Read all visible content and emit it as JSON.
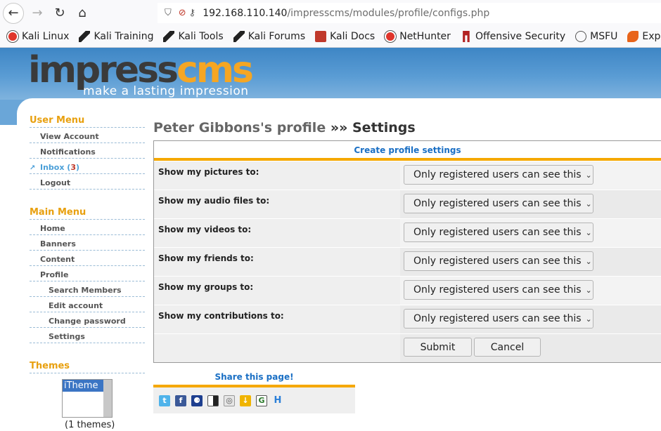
{
  "browser": {
    "url_host": "192.168.110.140",
    "url_path": "/impresscms/modules/profile/configs.php",
    "bookmarks": [
      {
        "label": "Kali Linux",
        "icon": "kali-icon"
      },
      {
        "label": "Kali Training",
        "icon": "kali-dragon-icon"
      },
      {
        "label": "Kali Tools",
        "icon": "kali-dragon-icon"
      },
      {
        "label": "Kali Forums",
        "icon": "kali-dragon-icon"
      },
      {
        "label": "Kali Docs",
        "icon": "kali-docs-icon"
      },
      {
        "label": "NetHunter",
        "icon": "kali-icon"
      },
      {
        "label": "Offensive Security",
        "icon": "offsec-icon"
      },
      {
        "label": "MSFU",
        "icon": "globe-icon"
      },
      {
        "label": "Exploit-DB",
        "icon": "exploitdb-icon"
      }
    ]
  },
  "logo": {
    "impress": "impress",
    "cms": "cms",
    "tagline": "make a lasting impression"
  },
  "sidebar": {
    "user_menu": {
      "title": "User Menu",
      "items": [
        "View Account",
        "Notifications",
        "Inbox",
        "Logout"
      ],
      "inbox_count": "3"
    },
    "main_menu": {
      "title": "Main Menu",
      "items": [
        "Home",
        "Banners",
        "Content",
        "Profile"
      ],
      "profile_sub": [
        "Search Members",
        "Edit account",
        "Change password",
        "Settings"
      ]
    },
    "themes": {
      "title": "Themes",
      "selected": "iTheme",
      "count": "(1 themes)"
    }
  },
  "main": {
    "title_user": "Peter Gibbons's profile",
    "title_sep": " »» ",
    "title_page": "Settings",
    "table_head": "Create profile settings",
    "rows": [
      {
        "label": "Show my pictures to:",
        "value": "Only registered users can see this"
      },
      {
        "label": "Show my audio files to:",
        "value": "Only registered users can see this"
      },
      {
        "label": "Show my videos to:",
        "value": "Only registered users can see this"
      },
      {
        "label": "Show my friends to:",
        "value": "Only registered users can see this"
      },
      {
        "label": "Show my groups to:",
        "value": "Only registered users can see this"
      },
      {
        "label": "Show my contributions to:",
        "value": "Only registered users can see this"
      }
    ],
    "submit_label": "Submit",
    "cancel_label": "Cancel"
  },
  "share": {
    "title": "Share this page!",
    "icons": [
      "twitter-icon",
      "facebook-icon",
      "myspace-icon",
      "delicious-icon",
      "digg-icon",
      "download-icon",
      "google-icon",
      "hi5-icon"
    ]
  },
  "colors": {
    "accent_orange": "#f5a800",
    "link_blue": "#1a6fc4",
    "header_blue": "#4a8fcf"
  }
}
